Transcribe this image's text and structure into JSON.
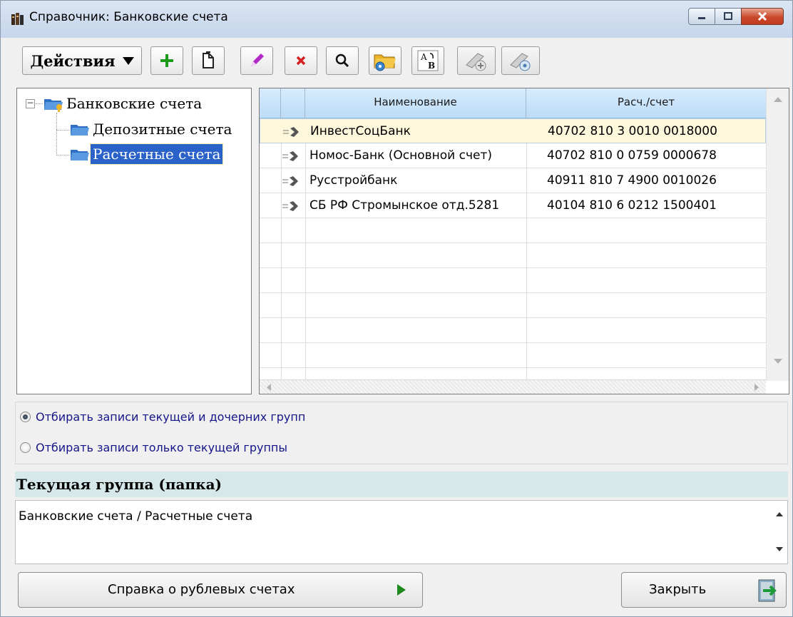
{
  "window": {
    "title": "Справочник: Банковские счета",
    "accent": "#2a62c9"
  },
  "toolbar": {
    "actions_label": "Действия",
    "icons": [
      "add-icon",
      "copy-icon",
      "edit-icon",
      "delete-icon",
      "search-icon",
      "folder-settings-icon",
      "sort-ab-icon",
      "add-record-icon",
      "record-settings-icon"
    ]
  },
  "tree": {
    "root": "Банковские счета",
    "children": [
      "Депозитные счета",
      "Расчетные счета"
    ],
    "selected": "Расчетные счета"
  },
  "grid": {
    "columns": [
      "Наименование",
      "Расч./счет"
    ],
    "rows": [
      {
        "name": "ИнвестСоцБанк",
        "account": "40702 810 3 0010 0018000"
      },
      {
        "name": "Номос-Банк (Основной счет)",
        "account": "40702 810 0 0759 0000678"
      },
      {
        "name": "Русстройбанк",
        "account": "40911 810 7 4900 0010026"
      },
      {
        "name": "СБ РФ Стромынское отд.5281",
        "account": "40104 810 6 0212 1500401"
      }
    ],
    "active_row": 0
  },
  "filters": {
    "option1": "Отбирать записи текущей и дочерних групп",
    "option2": "Отбирать записи только текущей группы",
    "selected": 1
  },
  "current_group": {
    "header": "Текущая группа (папка)",
    "path": "Банковские счета / Расчетные счета"
  },
  "buttons": {
    "info": "Справка о рублевых счетах",
    "close": "Закрыть"
  }
}
